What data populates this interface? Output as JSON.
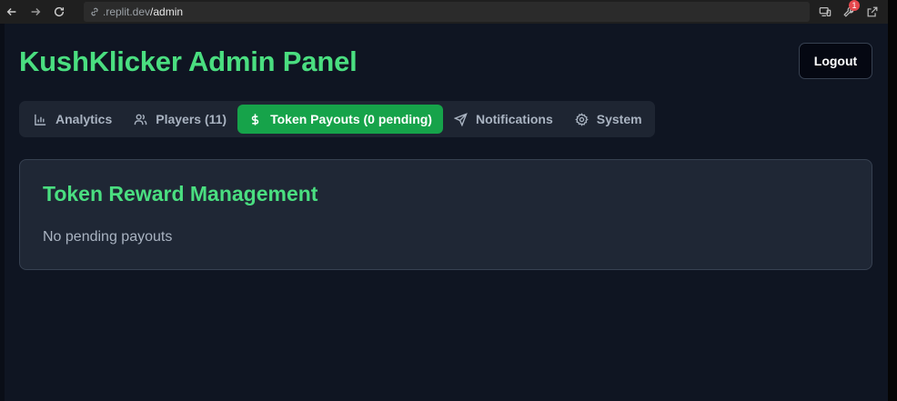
{
  "browser": {
    "url_host": ".replit.dev",
    "url_path": "/admin",
    "notification_count": "1"
  },
  "header": {
    "title": "KushKlicker Admin Panel",
    "logout_label": "Logout"
  },
  "tabs": [
    {
      "label": "Analytics",
      "icon": "bar-chart-icon",
      "active": false
    },
    {
      "label": "Players (11)",
      "icon": "users-icon",
      "active": false
    },
    {
      "label": "Token Payouts (0 pending)",
      "icon": "dollar-icon",
      "active": true
    },
    {
      "label": "Notifications",
      "icon": "send-icon",
      "active": false
    },
    {
      "label": "System",
      "icon": "gear-icon",
      "active": false
    }
  ],
  "card": {
    "title": "Token Reward Management",
    "empty_text": "No pending payouts"
  },
  "colors": {
    "accent": "#4ade80",
    "active_tab": "#16a34a",
    "background": "#0f1522",
    "card": "#1f2735"
  }
}
